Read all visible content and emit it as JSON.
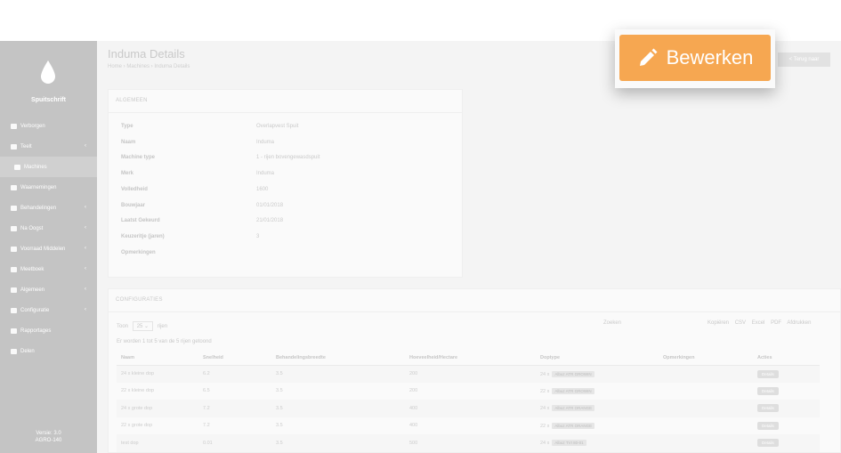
{
  "sidebar": {
    "brand": "Spuitschrift",
    "items": [
      {
        "label": "Verborgen",
        "chevron": false
      },
      {
        "label": "Teelt",
        "chevron": true
      },
      {
        "label": "Machines",
        "chevron": false
      },
      {
        "label": "Waarnemingen",
        "chevron": false
      },
      {
        "label": "Behandelingen",
        "chevron": true
      },
      {
        "label": "Na Oogst",
        "chevron": true
      },
      {
        "label": "Voorraad Middelen",
        "chevron": true
      },
      {
        "label": "Meetboek",
        "chevron": true
      },
      {
        "label": "Algemeen",
        "chevron": true
      },
      {
        "label": "Configuratie",
        "chevron": true
      },
      {
        "label": "Rapportages",
        "chevron": false
      },
      {
        "label": "Delen",
        "chevron": false
      }
    ],
    "version_line1": "Versie: 3.0",
    "version_line2": "AGRO-140"
  },
  "header": {
    "title": "Induma Details",
    "breadcrumb": "Home › Machines › Induma Details",
    "back_label": "< Terug naar"
  },
  "edit_button": {
    "label": "Bewerken",
    "icon": "pencil-icon",
    "color": "#f6a751"
  },
  "general": {
    "heading": "ALGEMEEN",
    "rows": [
      {
        "key": "Type",
        "value": "Overlapvest Spuit"
      },
      {
        "key": "Naam",
        "value": "Induma"
      },
      {
        "key": "Machine type",
        "value": "1 - rijen bovengewasdspuit"
      },
      {
        "key": "Merk",
        "value": "Induma"
      },
      {
        "key": "Volledheid",
        "value": "1600"
      },
      {
        "key": "Bouwjaar",
        "value": "01/01/2018"
      },
      {
        "key": "Laatst Gekeurd",
        "value": "21/01/2018"
      },
      {
        "key": "Keuzeritje (jaren)",
        "value": "3"
      },
      {
        "key": "Opmerkingen",
        "value": ""
      }
    ]
  },
  "config": {
    "heading": "CONFIGURATIES",
    "show_label": "Toon",
    "show_value": "25",
    "rows_label": "rijen",
    "search_label": "Zoeken",
    "exports": [
      "Kopiëren",
      "CSV",
      "Excel",
      "PDF",
      "Afdrukken"
    ],
    "info": "Er worden 1 tot 5 van de 5 rijen getoond",
    "columns": [
      "Naam",
      "Snelheid",
      "Behandelingsbreedte",
      "Hoeveelheid/Hectare",
      "Doptype",
      "Opmerkingen",
      "Acties"
    ],
    "rows": [
      {
        "naam": "24 x kleine dop",
        "snelheid": "6.2",
        "breedte": "3.5",
        "hoeveelheid": "200",
        "dop_count": "24 x",
        "dop_tag": "Albuz ATR GROWIN",
        "opm": "",
        "actie": "Details"
      },
      {
        "naam": "22 x kleine dop",
        "snelheid": "6.5",
        "breedte": "3.5",
        "hoeveelheid": "200",
        "dop_count": "22 x",
        "dop_tag": "Albuz ATR GROWIN",
        "opm": "",
        "actie": "Details"
      },
      {
        "naam": "24 x grote dop",
        "snelheid": "7.2",
        "breedte": "3.5",
        "hoeveelheid": "400",
        "dop_count": "24 x",
        "dop_tag": "Albuz ATR ORANGE",
        "opm": "",
        "actie": "Details"
      },
      {
        "naam": "22 x grote dop",
        "snelheid": "7.2",
        "breedte": "3.5",
        "hoeveelheid": "400",
        "dop_count": "22 x",
        "dop_tag": "Albuz ATR ORANGE",
        "opm": "",
        "actie": "Details"
      },
      {
        "naam": "test dop",
        "snelheid": "0.01",
        "breedte": "3.5",
        "hoeveelheid": "500",
        "dop_count": "24 x",
        "dop_tag": "Albuz TVI 80-01",
        "opm": "",
        "actie": "Details"
      }
    ]
  }
}
